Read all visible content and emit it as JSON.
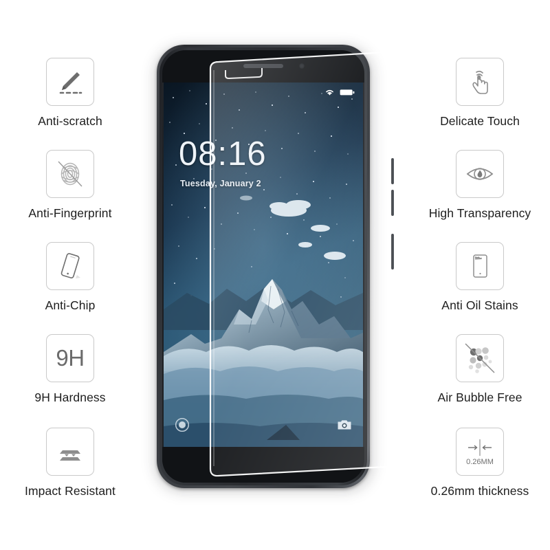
{
  "product": {
    "type": "tempered-glass-screen-protector-infographic",
    "background_color": "#ffffff",
    "label_color": "#1d1d1d",
    "icon_border_color": "#c9c9c9",
    "icon_fill_color": "#8e8e8e"
  },
  "features_left": [
    {
      "label": "Anti-scratch",
      "icon": "knife-scratch-icon"
    },
    {
      "label": "Anti-Fingerprint",
      "icon": "fingerprint-crossed-icon"
    },
    {
      "label": "Anti-Chip",
      "icon": "tilted-phone-icon"
    },
    {
      "label": "9H Hardness",
      "icon": "9h-text-icon",
      "icon_text": "9H"
    },
    {
      "label": "Impact Resistant",
      "icon": "layered-plates-icon"
    }
  ],
  "features_right": [
    {
      "label": "Delicate Touch",
      "icon": "touch-hand-icon"
    },
    {
      "label": "High Transparency",
      "icon": "eye-icon"
    },
    {
      "label": "Anti Oil Stains",
      "icon": "phone-oil-stain-icon"
    },
    {
      "label": "Air Bubble Free",
      "icon": "bubbles-crossed-icon"
    },
    {
      "label": "0.26mm thickness",
      "icon": "thickness-arrows-icon",
      "icon_text": "0.26MM"
    }
  ],
  "phone": {
    "lockscreen": {
      "time": "08:16",
      "date": "Tuesday, January 2",
      "wallpaper": "snowy-mountain-peak-starry-night",
      "status_icons": [
        "wifi-icon",
        "battery-icon"
      ],
      "shortcut_left": "unlock-circle-icon",
      "shortcut_right": "camera-icon"
    },
    "body_color": "#2b2d31",
    "screen_color": "#0d1925"
  },
  "glass_overlay": {
    "description": "tilted transparent tempered glass sheet over phone",
    "edge_color": "#ffffff",
    "opacity": "0.12"
  }
}
